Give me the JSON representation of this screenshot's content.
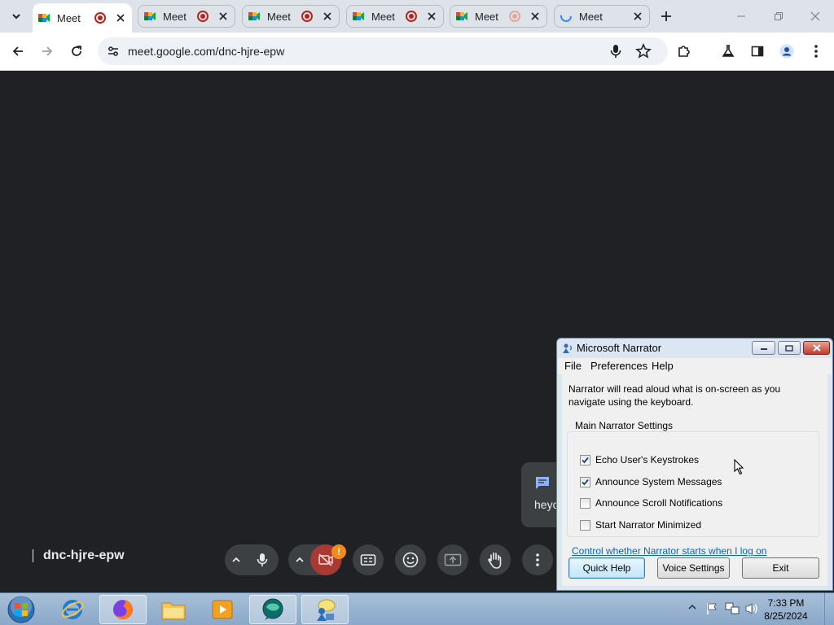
{
  "browser": {
    "tabs": [
      {
        "title": "Meet",
        "active": true,
        "recording": true
      },
      {
        "title": "Meet",
        "active": false,
        "recording": true
      },
      {
        "title": "Meet",
        "active": false,
        "recording": true
      },
      {
        "title": "Meet",
        "active": false,
        "recording": true
      },
      {
        "title": "Meet",
        "active": false,
        "recording": "faded"
      },
      {
        "title": "Meet",
        "active": false,
        "recording": false
      }
    ],
    "url": "meet.google.com/dnc-hjre-epw"
  },
  "meet": {
    "meeting_code": "dnc-hjre-epw",
    "chat_snippet": "heyo",
    "camera_badge": "!"
  },
  "narrator": {
    "title": "Microsoft Narrator",
    "menu": [
      "File",
      "Preferences",
      "Help"
    ],
    "description": "Narrator will read aloud what is on-screen as you navigate using the keyboard.",
    "group_title": "Main Narrator Settings",
    "options": [
      {
        "label": "Echo User's Keystrokes",
        "checked": true
      },
      {
        "label": "Announce System Messages",
        "checked": true
      },
      {
        "label": "Announce Scroll Notifications",
        "checked": false
      },
      {
        "label": "Start Narrator Minimized",
        "checked": false
      }
    ],
    "link": "Control whether Narrator starts when I log on",
    "buttons": {
      "quick_help": "Quick Help",
      "voice_settings": "Voice Settings",
      "exit": "Exit"
    }
  },
  "taskbar": {
    "time": "7:33 PM",
    "date": "8/25/2024"
  },
  "colors": {
    "meet_bg": "#202124",
    "cam_off": "#a83a33",
    "badge": "#f28b1e",
    "link": "#0066cc"
  }
}
